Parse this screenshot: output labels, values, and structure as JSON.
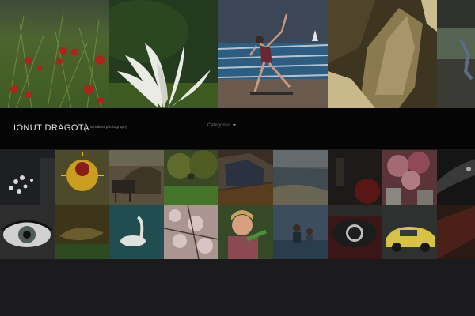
{
  "site": {
    "title": "IONUT DRAGOTA",
    "tagline": "amateur photography"
  },
  "nav": {
    "categories_label": "Categories"
  },
  "top_gallery": [
    {
      "icon": "poppy-field-photo"
    },
    {
      "icon": "water-lily-photo"
    },
    {
      "icon": "skateboarder-photo"
    },
    {
      "icon": "golden-leaf-photo"
    },
    {
      "icon": "partial-street-photo"
    }
  ],
  "grid_gallery": [
    {
      "icon": "white-flower-photo"
    },
    {
      "icon": "yellow-flower-photo"
    },
    {
      "icon": "horse-cart-photo"
    },
    {
      "icon": "green-trees-photo"
    },
    {
      "icon": "car-mirror-photo"
    },
    {
      "icon": "rocky-shore-photo"
    },
    {
      "icon": "dark-red-photo"
    },
    {
      "icon": "pink-blossom-photo"
    },
    {
      "icon": "dark-detail-photo"
    },
    {
      "icon": "eye-closeup-photo"
    },
    {
      "icon": "dry-leaf-photo"
    },
    {
      "icon": "swan-photo"
    },
    {
      "icon": "cherry-blossom-photo"
    },
    {
      "icon": "child-portrait-photo"
    },
    {
      "icon": "people-water-photo"
    },
    {
      "icon": "car-logo-photo"
    },
    {
      "icon": "yellow-car-photo"
    },
    {
      "icon": "dark-red-corner-photo"
    }
  ]
}
